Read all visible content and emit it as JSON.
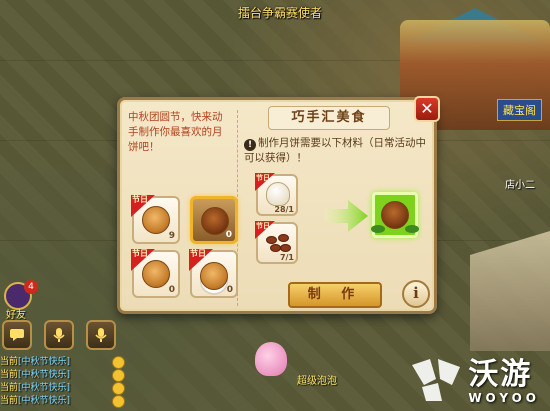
{
  "world": {
    "top_text": "擂台争霸赛使者",
    "store_sign": "藏宝阁",
    "npc_right": "店小二",
    "level_npc": "超级泡泡"
  },
  "friends": {
    "label": "好友",
    "badge": "4"
  },
  "chat": {
    "lines": [
      {
        "channel": "当前",
        "tag": "[中秋节快乐]"
      },
      {
        "channel": "当前",
        "tag": "[中秋节快乐]"
      },
      {
        "channel": "当前",
        "tag": "[中秋节快乐]"
      },
      {
        "channel": "当前",
        "tag": "[中秋节快乐]"
      }
    ]
  },
  "dialog": {
    "title": "巧手汇美食",
    "intro": "中秋团圆节，快来动手制作你最喜欢的月饼吧！",
    "info": "制作月饼需要以下材料（日常活动中可以获得）！",
    "make_label": "制 作",
    "info_button": "i",
    "close_label": "✕",
    "ribbon_text": "节日",
    "mooncakes": [
      {
        "count": "9",
        "selected": false,
        "style": "light"
      },
      {
        "count": "0",
        "selected": true,
        "style": "dark"
      },
      {
        "count": "0",
        "selected": false,
        "style": "light"
      },
      {
        "count": "0",
        "selected": false,
        "style": "plate"
      }
    ],
    "materials": [
      {
        "name": "flour",
        "count": "28/1"
      },
      {
        "name": "beans",
        "count": "7/1"
      }
    ]
  },
  "watermark": {
    "cn": "沃游",
    "en": "WOYOO"
  }
}
